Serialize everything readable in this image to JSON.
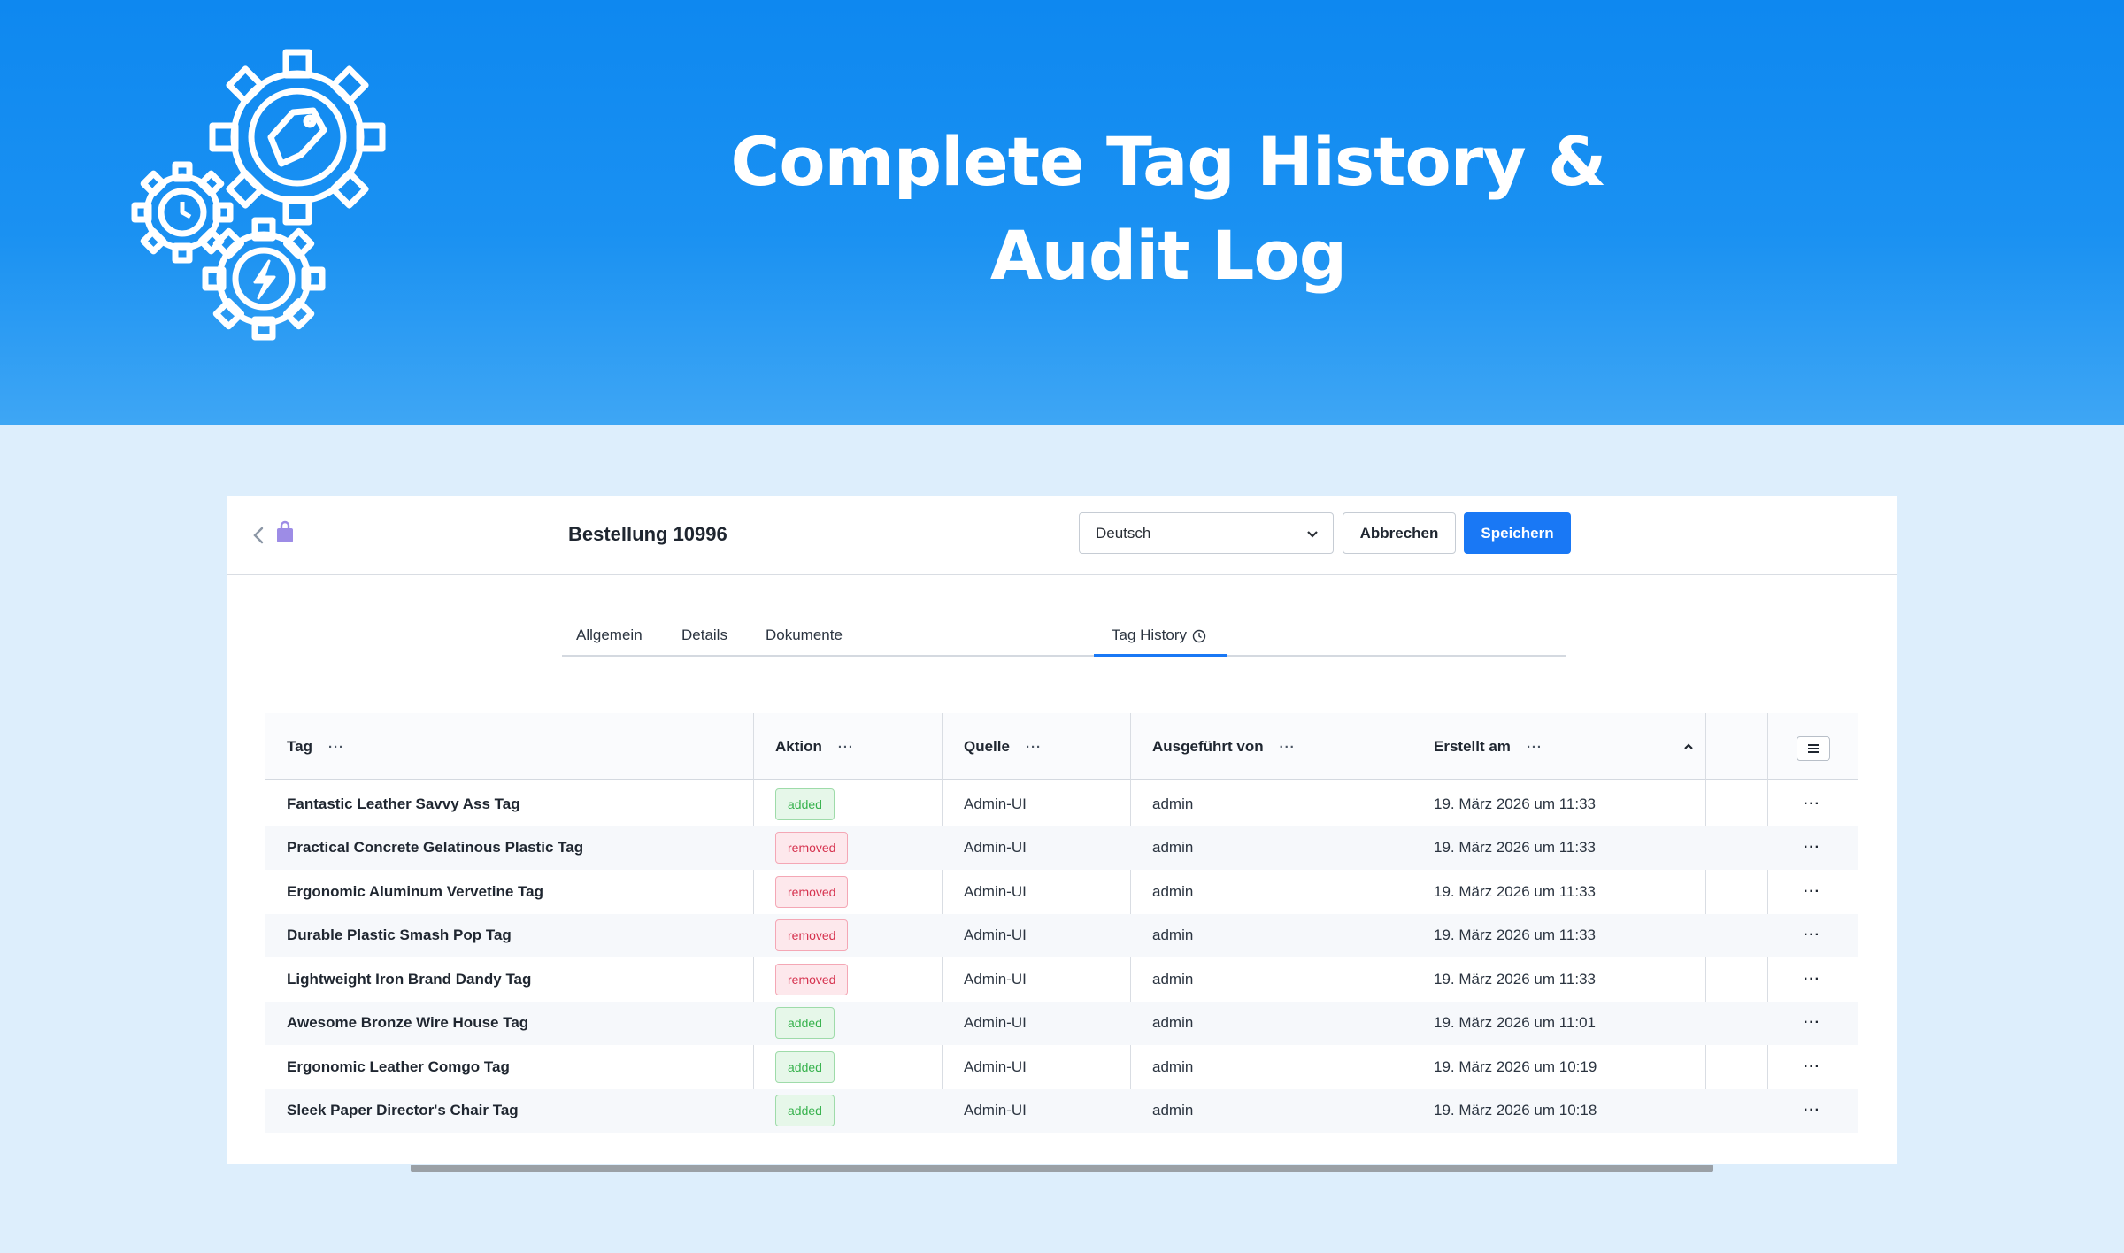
{
  "hero": {
    "title_line1": "Complete Tag History &",
    "title_line2": "Audit Log"
  },
  "header": {
    "title": "Bestellung 10996",
    "language_value": "Deutsch",
    "cancel_label": "Abbrechen",
    "save_label": "Speichern"
  },
  "tabs": [
    {
      "label": "Allgemein",
      "active": false
    },
    {
      "label": "Details",
      "active": false
    },
    {
      "label": "Dokumente",
      "active": false
    },
    {
      "label": "Tag History",
      "active": true
    }
  ],
  "table": {
    "columns": [
      "Tag",
      "Aktion",
      "Quelle",
      "Ausgeführt von",
      "Erstellt am"
    ],
    "sort_column": "Erstellt am",
    "sort_direction": "ascending",
    "rows": [
      {
        "tag": "Fantastic Leather Savvy Ass Tag",
        "action": "added",
        "source": "Admin-UI",
        "user": "admin",
        "created": "19. März 2026 um 11:33"
      },
      {
        "tag": "Practical Concrete Gelatinous Plastic Tag",
        "action": "removed",
        "source": "Admin-UI",
        "user": "admin",
        "created": "19. März 2026 um 11:33"
      },
      {
        "tag": "Ergonomic Aluminum Vervetine Tag",
        "action": "removed",
        "source": "Admin-UI",
        "user": "admin",
        "created": "19. März 2026 um 11:33"
      },
      {
        "tag": "Durable Plastic Smash Pop Tag",
        "action": "removed",
        "source": "Admin-UI",
        "user": "admin",
        "created": "19. März 2026 um 11:33"
      },
      {
        "tag": "Lightweight Iron Brand Dandy Tag",
        "action": "removed",
        "source": "Admin-UI",
        "user": "admin",
        "created": "19. März 2026 um 11:33"
      },
      {
        "tag": "Awesome Bronze Wire House Tag",
        "action": "added",
        "source": "Admin-UI",
        "user": "admin",
        "created": "19. März 2026 um 11:01"
      },
      {
        "tag": "Ergonomic Leather Comgo Tag",
        "action": "added",
        "source": "Admin-UI",
        "user": "admin",
        "created": "19. März 2026 um 10:19"
      },
      {
        "tag": "Sleek Paper Director's Chair Tag",
        "action": "added",
        "source": "Admin-UI",
        "user": "admin",
        "created": "19. März 2026 um 10:18"
      }
    ]
  },
  "colors": {
    "hero_blue": "#0e88f0",
    "primary": "#1978f5",
    "added": "#37b24d",
    "removed": "#d6334f",
    "page_bg": "#ddeefc"
  },
  "icons": [
    "gears-tag-history-icon",
    "back-chevron-icon",
    "shopping-bag-icon",
    "chevron-down-icon",
    "history-clock-icon",
    "sort-up-icon",
    "column-menu-icon",
    "more-dots-icon"
  ]
}
